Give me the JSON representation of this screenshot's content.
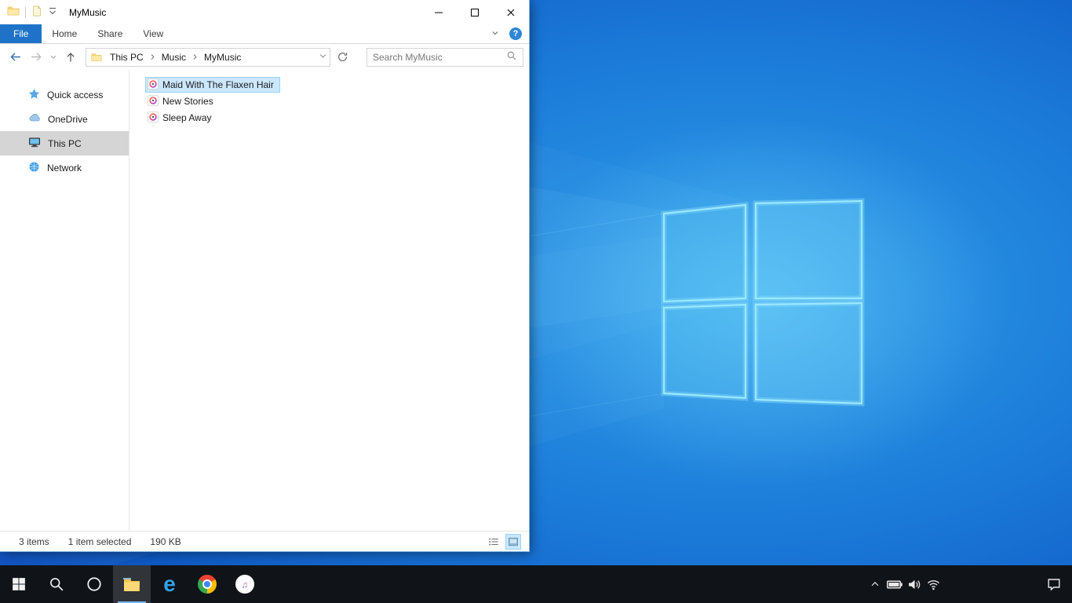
{
  "explorer": {
    "title": "MyMusic",
    "ribbon": {
      "tabs": [
        "File",
        "Home",
        "Share",
        "View"
      ]
    },
    "nav": {
      "breadcrumbs": [
        "This PC",
        "Music",
        "MyMusic"
      ],
      "search_placeholder": "Search MyMusic"
    },
    "sidebar": {
      "items": [
        {
          "label": "Quick access"
        },
        {
          "label": "OneDrive"
        },
        {
          "label": "This PC"
        },
        {
          "label": "Network"
        }
      ]
    },
    "files": [
      {
        "name": "Maid With The Flaxen Hair",
        "selected": true
      },
      {
        "name": "New Stories",
        "selected": false
      },
      {
        "name": "Sleep Away",
        "selected": false
      }
    ],
    "status": {
      "count": "3 items",
      "selection": "1 item selected",
      "size": "190 KB"
    }
  },
  "icons": {
    "help_glyph": "?",
    "edge_glyph": "e",
    "itunes_note": "♫"
  },
  "colors": {
    "accent": "#0078d7",
    "file_tab": "#1e73c8",
    "selection_bg": "#cce8ff",
    "selection_border": "#99d1ff",
    "taskbar": "#101318",
    "wallpaper_light": "#2f9fea",
    "wallpaper_dark": "#0a4fbe"
  }
}
